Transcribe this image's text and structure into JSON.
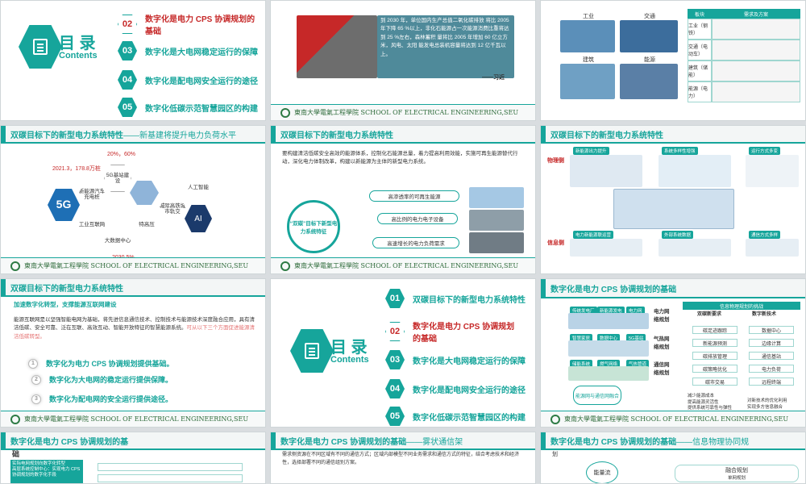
{
  "school": "東南大學電氣工程學院 SCHOOL OF ELECTRICAL ENGINEERING,SEU",
  "agenda": {
    "title": "目 录",
    "subtitle": "Contents",
    "items": [
      {
        "num": "01",
        "label": "双碳目标下的新型电力系统特性"
      },
      {
        "num": "02",
        "label": "数字化是电力 CPS 协调规划的基础"
      },
      {
        "num": "03",
        "label": "数字化是大电网稳定运行的保障"
      },
      {
        "num": "04",
        "label": "数字化是配电网安全运行的途径"
      },
      {
        "num": "05",
        "label": "数字化低碳示范智慧园区的构建"
      }
    ]
  },
  "slide_quote": {
    "text": "到 2030 年，单位国内生产总值二氧化碳排放 将比 2005 年下降 65 %以上，非化石能源占一次能源消费比重将达到 25 %左右，森林蓄积 量将比 2005 年增加 60 亿立方米，风电、太阳 能发电总装机容量将达到 12 亿千瓦以上。",
    "author": "——习近"
  },
  "slide_industry": {
    "labels": [
      "工业",
      "交通",
      "建筑",
      "能源"
    ],
    "table_headers": [
      "板块",
      "需求及方案"
    ],
    "rows": [
      "工业（钢铁）",
      "交通（电动车）",
      "建筑（储能）",
      "能源（电力）"
    ]
  },
  "slide_loads": {
    "title": "双碳目标下的新型电力系统特性",
    "sub": "——新基建将提升电力负荷水平",
    "center": "5G",
    "items": [
      "5G基站建设",
      "新能源汽车充电桩",
      "工业互联网",
      "大数据中心",
      "特高压",
      "城际高铁城市轨交",
      "人工智能"
    ],
    "stats": [
      "20%，60%",
      "2021.3，178.8万桩",
      "2030.5%"
    ]
  },
  "slide_features": {
    "title": "双碳目标下的新型电力系统特性",
    "intro": "要构建清洁低碳安全高效的能源体系，控制化石能源总量，着力提高利用效能，实施可再生能源替代行动，深化电力体制改革，构建以新能源为主体的新型电力系统。",
    "center": "“双碳”目标下新型电力系统特征",
    "features": [
      "高渗透率的可再生能源",
      "高比例的电力电子设备",
      "高速增长的电力负荷需求"
    ]
  },
  "slide_map": {
    "title": "双碳目标下的新型电力系统特性",
    "side_labels": [
      "物理侧",
      "信息侧"
    ],
    "chips": [
      "新能源出力提升",
      "系统多样性增强",
      "运行方式多变",
      "电力新能源联运营",
      "外部系统数据",
      "通信方式多样"
    ]
  },
  "slide_digital": {
    "title": "双碳目标下的新型电力系统特性",
    "sub": "加速数字化转型，支撑能源互联网建设",
    "body": "能源互联网是以坚强智能电网为基础，将先进信息通信技术、控制技术与能源技术深度融合应用，具有清洁低碳、安全可靠、泛在互联、高效互动、智能开放特征的智慧能源系统。",
    "highlight": "可从以下三个方面促进能源清洁低碳转型。",
    "points": [
      "数字化为电力 CPS 协调规划提供基础。",
      "数字化为大电网的稳定运行提供保障。",
      "数字化为配电网的安全运行提供途径。"
    ]
  },
  "slide_cps": {
    "title": "数字化是电力 CPS 协调规划的基础",
    "left_labels": [
      "传统发电厂",
      "新能源发电",
      "电力网",
      "智慧家居",
      "数据中心",
      "5G基站",
      "储能系统",
      "燃气网络",
      "气热管道"
    ],
    "mid_labels": [
      "电力网络规划",
      "气热网络规划",
      "通信网络规划"
    ],
    "panel_title": "信息物理规划的挑战",
    "col_heads": [
      "双碳新要求",
      "数字新技术"
    ],
    "left_items": [
      "碳足迹跟踪",
      "新能源预测",
      "碳排放管理",
      "碳策略优化",
      "碳市交易"
    ],
    "right_items": [
      "数据中心",
      "边缘计算",
      "通信基站",
      "电力负荷",
      "远程终端"
    ],
    "oval": "能源网与通信网融合",
    "notes_left": [
      "减少能源成本",
      "提高能源灵活性",
      "提供系统可靠性与弹性"
    ],
    "notes_right": [
      "对新技术的优化利用",
      "实现多方信息融合"
    ]
  },
  "slide_cps2": {
    "title": "数字化是电力 CPS 协调规划的基",
    "title2": "础",
    "bullets": [
      "实际电网规划向数字化转型",
      "高层系统控制中心：实现电力 CPS 协调规划的数字化手段"
    ]
  },
  "slide_comm": {
    "title": "数字化是电力 CPS 协调规划的基础",
    "sub": "——雾状通信架",
    "body": "需求侧资源在不同区域有不同的通信方式；区域内部模型不同业务需求和通信方式的特征，结合考虑技术和经济性，选择部署不同的通信组别方案。"
  },
  "slide_fusion": {
    "title": "数字化是电力 CPS 协调规划的基础",
    "sub": "——信息物理协同规",
    "sub2": "划",
    "left": "能量流",
    "right": "融合规划",
    "right2": "单网规划"
  }
}
